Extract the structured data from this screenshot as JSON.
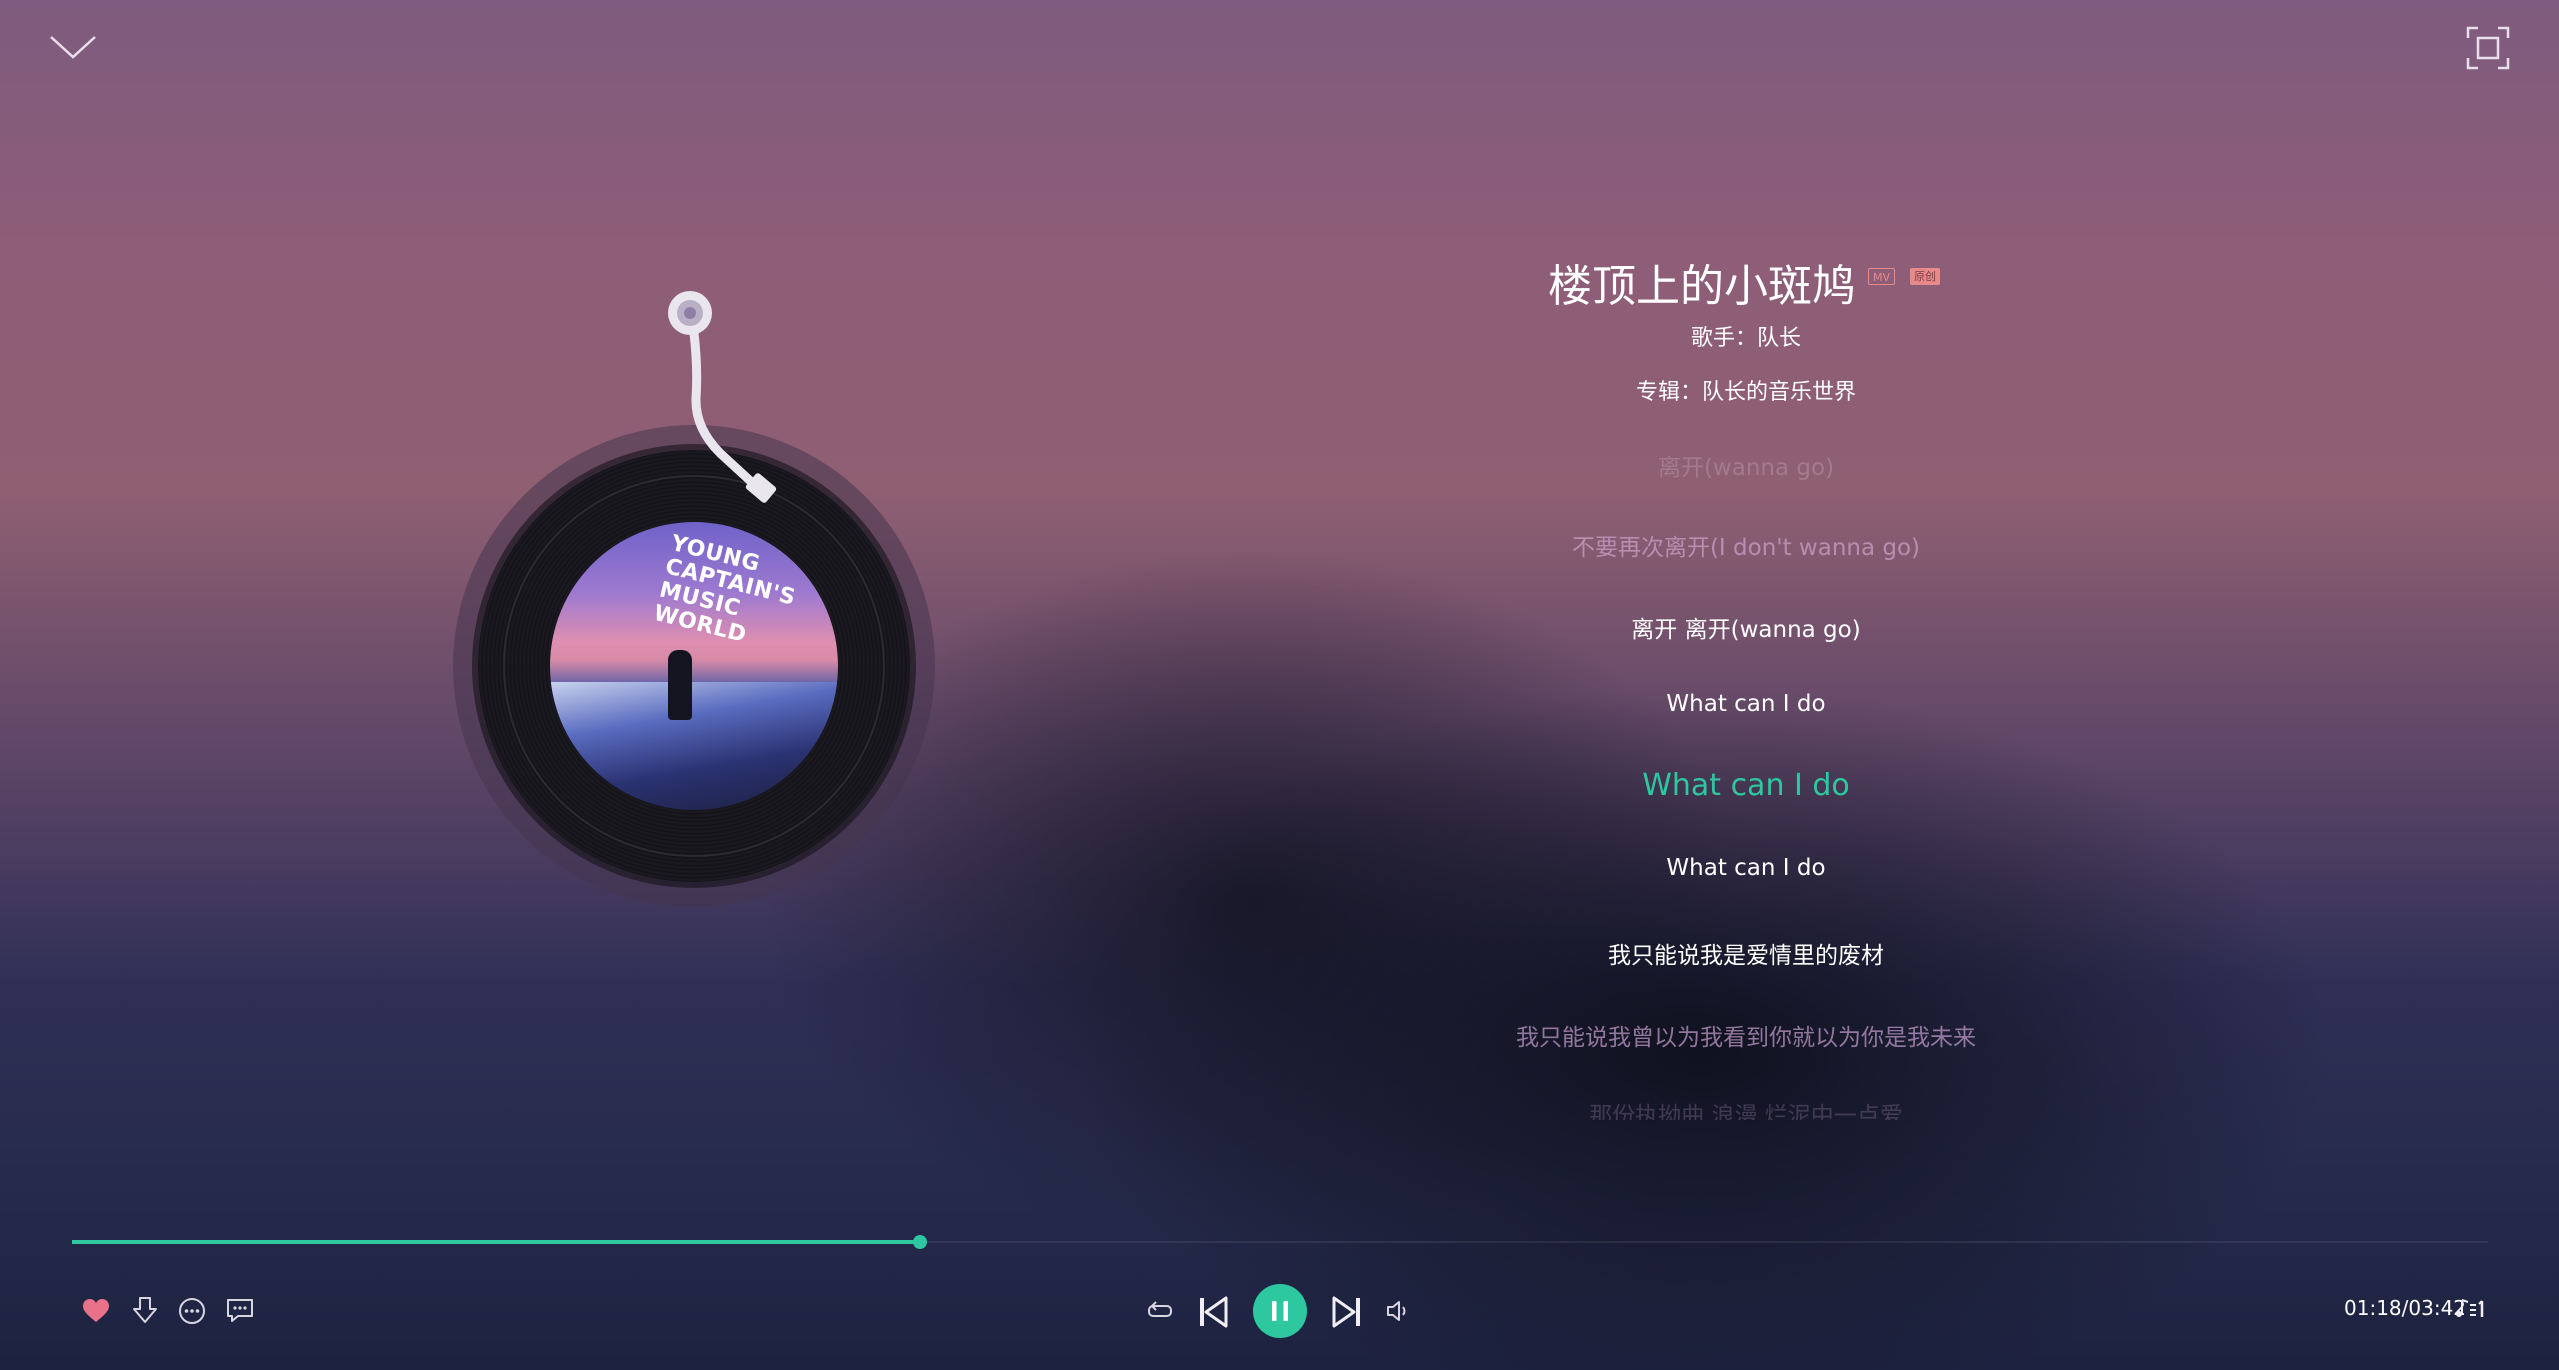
{
  "song": {
    "title": "楼顶上的小斑鸠",
    "badge_mv": "MV",
    "badge_original": "原创",
    "singer_line": "歌手：队长",
    "album_line": "专辑：队长的音乐世界"
  },
  "cover_art": {
    "text_line1": "YOUNG CAPTAIN'S",
    "text_line2": "MUSIC WORLD"
  },
  "lyrics": [
    {
      "text": "离开(wanna go)",
      "state": "far"
    },
    {
      "text": "不要再次离开(I don't wanna go)",
      "state": "near"
    },
    {
      "text": "离开 离开(wanna go)",
      "state": "normal"
    },
    {
      "text": "What can I do",
      "state": "normal"
    },
    {
      "text": "What can I do",
      "state": "active"
    },
    {
      "text": "What can I do",
      "state": "normal"
    },
    {
      "text": "我只能说我是爱情里的废材",
      "state": "normal"
    },
    {
      "text": "我只能说我曾以为我看到你就以为你是我未来",
      "state": "near"
    },
    {
      "text": "那份执拗曲 浪漫 烂泥中一点爱",
      "state": "far"
    }
  ],
  "playback": {
    "current_time": "01:18",
    "total_time": "03:42",
    "time_display": "01:18/03:42",
    "progress_fraction": 0.351,
    "liked": true
  },
  "icons": {
    "collapse": "chevron-down-icon",
    "fullscreen": "fullscreen-icon",
    "like": "heart-icon",
    "download": "download-icon",
    "more": "more-icon",
    "comment": "comment-icon",
    "loop": "loop-icon",
    "prev": "previous-icon",
    "pause": "pause-icon",
    "next": "next-icon",
    "volume": "volume-icon",
    "playlist": "playlist-icon"
  },
  "colors": {
    "accent": "#2dc8a0",
    "like": "#e8728a",
    "badge": "#e88a8a"
  }
}
